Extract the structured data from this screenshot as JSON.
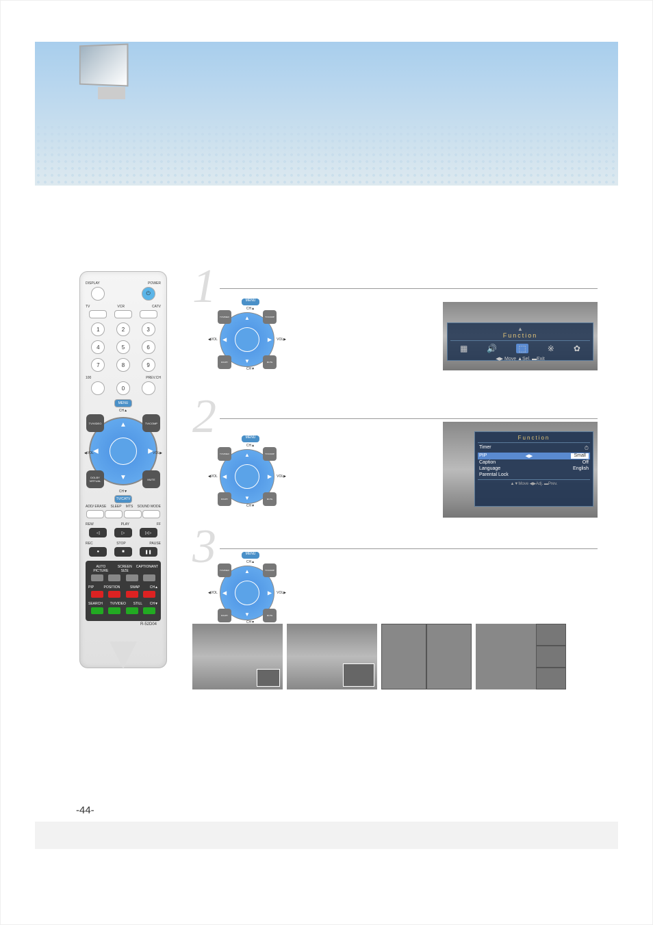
{
  "page_number": "-44-",
  "remote": {
    "labels": {
      "display": "DISPLAY",
      "power": "POWER",
      "tv": "TV",
      "vcr": "VCR",
      "catv": "CATV",
      "100": "100",
      "prev_ch": "PREV.CH",
      "menu": "MENU",
      "cha": "CH▲",
      "chv": "CH▼",
      "volL": "◀VOL",
      "volR": "VOL▶",
      "tvcatv": "TV/CATV",
      "tvvideo": "TV/VIDEO",
      "tvcomp": "TV/COMP",
      "dolby": "DOLBY VIRTUAL",
      "mute": "MUTE",
      "add_erase": "ADD/\nERASE",
      "sleep": "SLEEP",
      "mts": "MTS",
      "sound_mode": "SOUND\nMODE",
      "rew": "REW",
      "play": "PLAY",
      "ff": "FF",
      "rec": "REC",
      "stop": "STOP",
      "pause": "PAUSE",
      "auto_picture": "AUTO\nPICTURE",
      "screen_size": "SCREEN\nSIZE",
      "caption": "CAPTION",
      "ant": "ANT",
      "pip": "PIP",
      "position": "POSITION",
      "swap": "SWAP",
      "chup_box": "CH▲",
      "search": "SEARCH",
      "tvvideo_b": "TV/VIDEO",
      "still": "STILL",
      "chdn_box": "CH▼",
      "model": "R-52D04"
    },
    "keypad": [
      "1",
      "2",
      "3",
      "4",
      "5",
      "6",
      "7",
      "8",
      "9",
      "0"
    ]
  },
  "osd1": {
    "title": "Function",
    "footer": "◀▶ Move  ▲Sel.  ▬Exit"
  },
  "osd2": {
    "title": "Function",
    "items": [
      {
        "label": "Timer",
        "value": "",
        "icon": "⏱"
      },
      {
        "label": "PIP",
        "value": "Small",
        "sel": true,
        "arrows": true
      },
      {
        "label": "Caption",
        "value": "Off"
      },
      {
        "label": "Language",
        "value": "English"
      },
      {
        "label": "Parental Lock",
        "value": ""
      }
    ],
    "footer": "▲▼Move   ◀▶Adj.   ▬Prev."
  },
  "mini_labels": {
    "menu": "MENU",
    "cha": "CH▲",
    "chv": "CH▼",
    "volL": "◀VOL",
    "volR": "VOL▶"
  }
}
